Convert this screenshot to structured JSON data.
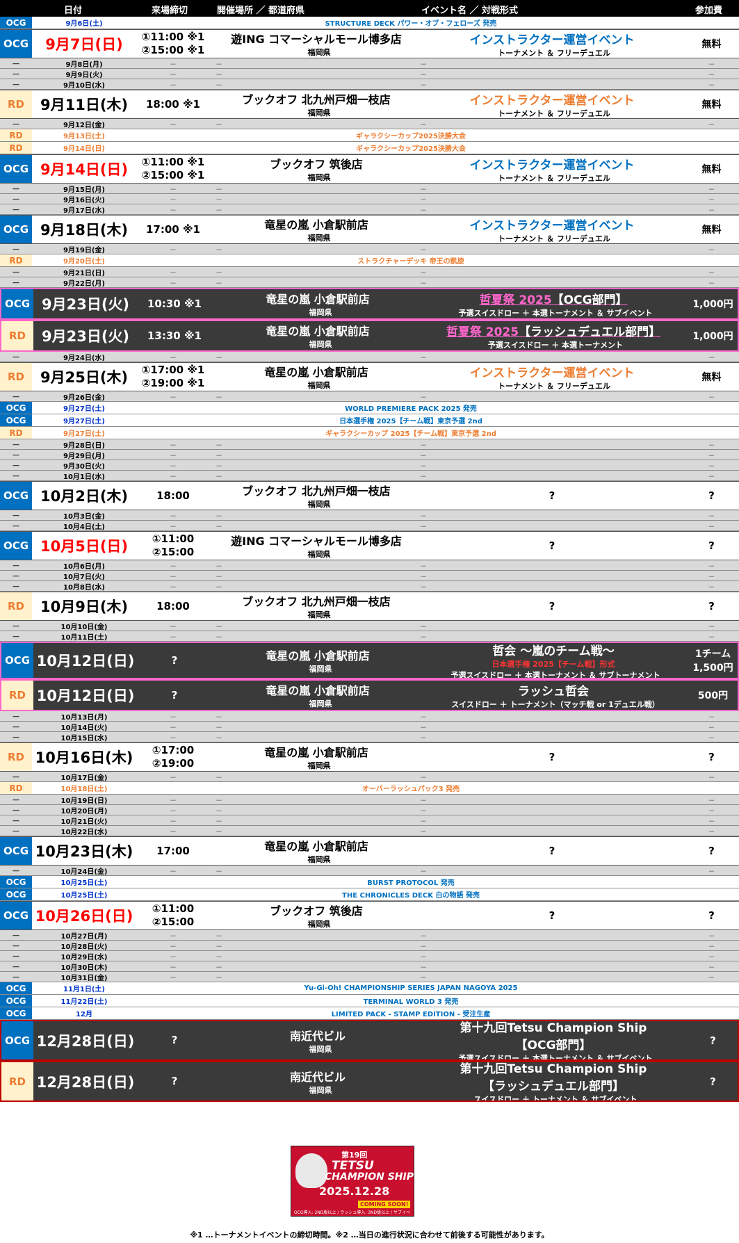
{
  "header": {
    "date": "日付",
    "deadline": "来場締切",
    "venue": "開催場所 ／ 都道府県",
    "event": "イベント名 ／ 対戦形式",
    "fee": "参加費"
  },
  "rows": [
    {
      "t": "banner",
      "badge": "OCG",
      "date": "9月6日(土)",
      "text": "STRUCTURE DECK パワー・オブ・フェローズ 発売"
    },
    {
      "t": "big",
      "badge": "OCG",
      "date": "9月7日(日)",
      "red": true,
      "dl": [
        "①11:00 ※1",
        "②15:00 ※1"
      ],
      "venue": "遊ING コマーシャルモール博多店",
      "pref": "福岡県",
      "ev": "インストラクター運営イベント",
      "evc": "blue",
      "sub": "トーナメント ＆ フリーデュエル",
      "fee": "無料"
    },
    {
      "t": "gray",
      "date": "9月8日(月)"
    },
    {
      "t": "gray",
      "date": "9月9日(火)"
    },
    {
      "t": "gray",
      "date": "9月10日(水)"
    },
    {
      "t": "big",
      "badge": "RD",
      "date": "9月11日(木)",
      "dl": [
        "18:00 ※1"
      ],
      "venue": "ブックオフ 北九州戸畑一枝店",
      "pref": "福岡県",
      "ev": "インストラクター運営イベント",
      "evc": "orange",
      "sub": "トーナメント ＆ フリーデュエル",
      "fee": "無料"
    },
    {
      "t": "gray",
      "date": "9月12日(金)"
    },
    {
      "t": "banner",
      "badge": "RD",
      "date": "9月13日(土)",
      "text": "ギャラクシーカップ2025決勝大会"
    },
    {
      "t": "banner",
      "badge": "RD",
      "date": "9月14日(日)",
      "text": "ギャラクシーカップ2025決勝大会"
    },
    {
      "t": "big",
      "badge": "OCG",
      "date": "9月14日(日)",
      "red": true,
      "dl": [
        "①11:00 ※1",
        "②15:00 ※1"
      ],
      "venue": "ブックオフ 筑後店",
      "pref": "福岡県",
      "ev": "インストラクター運営イベント",
      "evc": "blue",
      "sub": "トーナメント ＆ フリーデュエル",
      "fee": "無料"
    },
    {
      "t": "gray",
      "date": "9月15日(月)"
    },
    {
      "t": "gray",
      "date": "9月16日(火)"
    },
    {
      "t": "gray",
      "date": "9月17日(水)"
    },
    {
      "t": "big",
      "badge": "OCG",
      "date": "9月18日(木)",
      "dl": [
        "17:00 ※1"
      ],
      "venue": "竜星の嵐 小倉駅前店",
      "pref": "福岡県",
      "ev": "インストラクター運営イベント",
      "evc": "blue",
      "sub": "トーナメント ＆ フリーデュエル",
      "fee": "無料"
    },
    {
      "t": "gray",
      "date": "9月19日(金)"
    },
    {
      "t": "banner",
      "badge": "RD",
      "date": "9月20日(土)",
      "text": "ストラクチャーデッキ 帝王の凱旋"
    },
    {
      "t": "gray",
      "date": "9月21日(日)"
    },
    {
      "t": "gray",
      "date": "9月22日(月)"
    },
    {
      "t": "dark",
      "frame": "pink",
      "badge": "OCG",
      "date": "9月23日(火)",
      "dl": [
        "10:30 ※1"
      ],
      "venue": "竜星の嵐 小倉駅前店",
      "pref": "福岡県",
      "ev": "哲夏祭 2025",
      "evtail": "【OCG部門】",
      "evc": "pink",
      "sub": "予選スイスドロー ＋ 本選トーナメント ＆ サブイベント",
      "fee": "1,000円"
    },
    {
      "t": "dark",
      "frame": "pink",
      "badge": "RD",
      "date": "9月23日(火)",
      "dl": [
        "13:30 ※1"
      ],
      "venue": "竜星の嵐 小倉駅前店",
      "pref": "福岡県",
      "ev": "哲夏祭 2025",
      "evtail": "【ラッシュデュエル部門】",
      "evc": "pink",
      "sub": "予選スイスドロー ＋ 本選トーナメント",
      "fee": "1,000円"
    },
    {
      "t": "gray",
      "date": "9月24日(水)"
    },
    {
      "t": "big",
      "badge": "RD",
      "date": "9月25日(木)",
      "dl": [
        "①17:00 ※1",
        "②19:00 ※1"
      ],
      "venue": "竜星の嵐 小倉駅前店",
      "pref": "福岡県",
      "ev": "インストラクター運営イベント",
      "evc": "orange",
      "sub": "トーナメント ＆ フリーデュエル",
      "fee": "無料"
    },
    {
      "t": "gray",
      "date": "9月26日(金)"
    },
    {
      "t": "banner",
      "badge": "OCG",
      "date": "9月27日(土)",
      "text": "WORLD PREMIERE PACK 2025 発売"
    },
    {
      "t": "banner",
      "badge": "OCG",
      "date": "9月27日(土)",
      "text": "日本選手権 2025【チーム戦】東京予選 2nd"
    },
    {
      "t": "banner",
      "badge": "RD",
      "date": "9月27日(土)",
      "text": "ギャラクシーカップ 2025【チーム戦】東京予選 2nd"
    },
    {
      "t": "gray",
      "date": "9月28日(日)"
    },
    {
      "t": "gray",
      "date": "9月29日(月)"
    },
    {
      "t": "gray",
      "date": "9月30日(火)"
    },
    {
      "t": "gray",
      "date": "10月1日(水)"
    },
    {
      "t": "big",
      "badge": "OCG",
      "date": "10月2日(木)",
      "dl": [
        "18:00"
      ],
      "venue": "ブックオフ 北九州戸畑一枝店",
      "pref": "福岡県",
      "ev": "?",
      "fee": "?"
    },
    {
      "t": "gray",
      "date": "10月3日(金)"
    },
    {
      "t": "gray",
      "date": "10月4日(土)"
    },
    {
      "t": "big",
      "badge": "OCG",
      "date": "10月5日(日)",
      "red": true,
      "dl": [
        "①11:00",
        "②15:00"
      ],
      "venue": "遊ING コマーシャルモール博多店",
      "pref": "福岡県",
      "ev": "?",
      "fee": "?"
    },
    {
      "t": "gray",
      "date": "10月6日(月)"
    },
    {
      "t": "gray",
      "date": "10月7日(火)"
    },
    {
      "t": "gray",
      "date": "10月8日(水)"
    },
    {
      "t": "big",
      "badge": "RD",
      "date": "10月9日(木)",
      "dl": [
        "18:00"
      ],
      "venue": "ブックオフ 北九州戸畑一枝店",
      "pref": "福岡県",
      "ev": "?",
      "fee": "?"
    },
    {
      "t": "gray",
      "date": "10月10日(金)"
    },
    {
      "t": "gray",
      "date": "10月11日(土)"
    },
    {
      "t": "dark",
      "frame": "pink",
      "badge": "OCG",
      "date": "10月12日(日)",
      "dl": [
        "?"
      ],
      "venue": "竜星の嵐 小倉駅前店",
      "pref": "福岡県",
      "ev": "哲会 ～嵐のチーム戦～",
      "evc": "white",
      "evred": "日本選手権 2025【チーム戦】形式",
      "sub": "予選スイスドロー ＋ 本選トーナメント ＆ サブトーナメント",
      "fee": "1チーム",
      "fee2": "1,500円"
    },
    {
      "t": "dark",
      "frame": "pink",
      "badge": "RD",
      "date": "10月12日(日)",
      "dl": [
        "?"
      ],
      "venue": "竜星の嵐 小倉駅前店",
      "pref": "福岡県",
      "ev": "ラッシュ哲会",
      "evc": "white",
      "sub": "スイスドロー ＋ トーナメント（マッチ戦 or 1デュエル戦）",
      "fee": "500円"
    },
    {
      "t": "gray",
      "date": "10月13日(月)"
    },
    {
      "t": "gray",
      "date": "10月14日(火)"
    },
    {
      "t": "gray",
      "date": "10月15日(水)"
    },
    {
      "t": "big",
      "badge": "RD",
      "date": "10月16日(木)",
      "dl": [
        "①17:00",
        "②19:00"
      ],
      "venue": "竜星の嵐 小倉駅前店",
      "pref": "福岡県",
      "ev": "?",
      "fee": "?"
    },
    {
      "t": "gray",
      "date": "10月17日(金)"
    },
    {
      "t": "banner",
      "badge": "RD",
      "date": "10月18日(土)",
      "text": "オーバーラッシュパック3 発売"
    },
    {
      "t": "gray",
      "date": "10月19日(日)"
    },
    {
      "t": "gray",
      "date": "10月20日(月)"
    },
    {
      "t": "gray",
      "date": "10月21日(火)"
    },
    {
      "t": "gray",
      "date": "10月22日(水)"
    },
    {
      "t": "big",
      "badge": "OCG",
      "date": "10月23日(木)",
      "dl": [
        "17:00"
      ],
      "venue": "竜星の嵐 小倉駅前店",
      "pref": "福岡県",
      "ev": "?",
      "fee": "?"
    },
    {
      "t": "gray",
      "date": "10月24日(金)"
    },
    {
      "t": "banner",
      "badge": "OCG",
      "date": "10月25日(土)",
      "text": "BURST PROTOCOL 発売"
    },
    {
      "t": "banner",
      "badge": "OCG",
      "date": "10月25日(土)",
      "text": "THE CHRONICLES DECK 白の物語 発売"
    },
    {
      "t": "big",
      "badge": "OCG",
      "date": "10月26日(日)",
      "red": true,
      "dl": [
        "①11:00",
        "②15:00"
      ],
      "venue": "ブックオフ 筑後店",
      "pref": "福岡県",
      "ev": "?",
      "fee": "?"
    },
    {
      "t": "gray",
      "date": "10月27日(月)"
    },
    {
      "t": "gray",
      "date": "10月28日(火)"
    },
    {
      "t": "gray",
      "date": "10月29日(水)"
    },
    {
      "t": "gray",
      "date": "10月30日(木)"
    },
    {
      "t": "gray",
      "date": "10月31日(金)"
    },
    {
      "t": "banner",
      "badge": "OCG",
      "date": "11月1日(土)",
      "text": "Yu-Gi-Oh! CHAMPIONSHIP SERIES JAPAN NAGOYA 2025"
    },
    {
      "t": "banner",
      "badge": "OCG",
      "date": "11月22日(土)",
      "text": "TERMINAL WORLD 3 発売"
    },
    {
      "t": "banner",
      "badge": "OCG",
      "date": "12月",
      "text": "LIMITED PACK - STAMP EDITION - 受注生産"
    },
    {
      "t": "dark",
      "frame": "red",
      "badge": "OCG",
      "date": "12月28日(日)",
      "dl": [
        "?"
      ],
      "venue": "南近代ビル",
      "pref": "福岡県",
      "ev": "第十九回Tetsu Champion Ship",
      "ev2": "【OCG部門】",
      "evc": "white",
      "sub": "予選スイスドロー ＋ 本選トーナメント ＆ サブイベント",
      "fee": "?"
    },
    {
      "t": "dark",
      "frame": "red",
      "badge": "RD",
      "date": "12月28日(日)",
      "dl": [
        "?"
      ],
      "venue": "南近代ビル",
      "pref": "福岡県",
      "ev": "第十九回Tetsu Champion Ship",
      "ev2": "【ラッシュデュエル部門】",
      "evc": "white",
      "sub": "スイスドロー ＋ トーナメント ＆ サブイベント",
      "fee": "?"
    }
  ],
  "dash": "－",
  "poster": {
    "line1": "第19回",
    "line2": "TETSU",
    "line3": "CHAMPION SHIP",
    "line4": "2025.12.28",
    "badge": "COMING SOON!",
    "fine": "OCG導入: 2ND版以上 / ラッシュ導入: 3ND版以上 / サブイベント完成"
  },
  "footer": "※1 …トーナメントイベントの締切時間。※2 …当日の進行状況に合わせて前後する可能性があります。"
}
